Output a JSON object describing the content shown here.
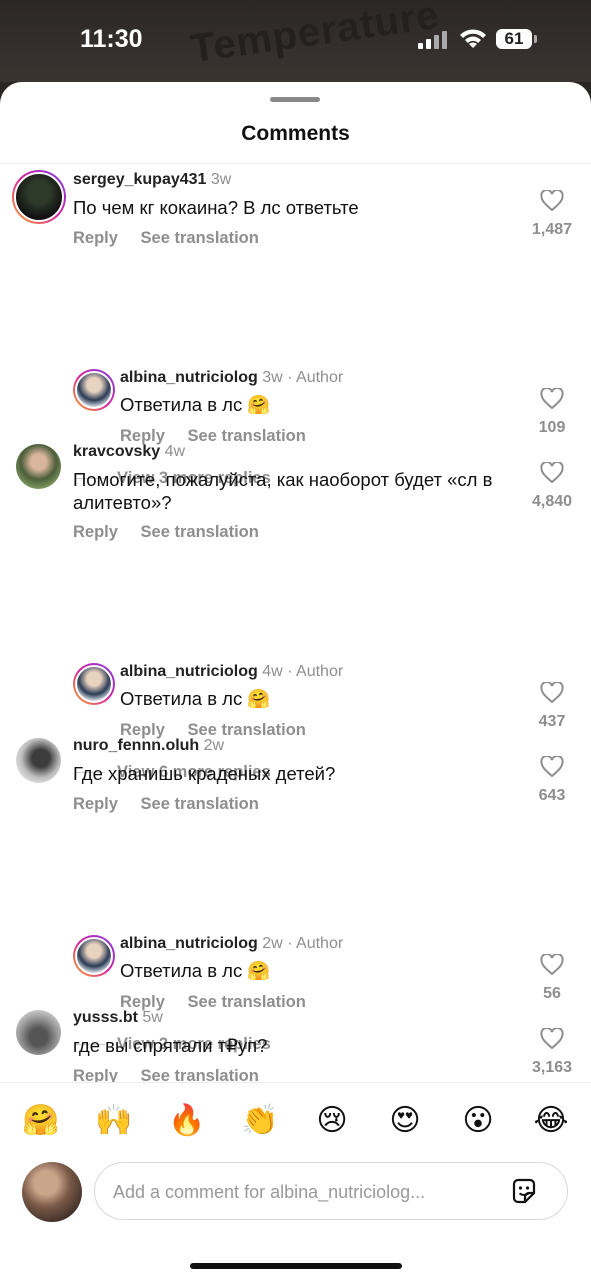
{
  "status_bar": {
    "time": "11:30",
    "battery": "61",
    "background_text": "Temperature",
    "icons": [
      "signal-icon",
      "wifi-icon",
      "battery-icon"
    ]
  },
  "sheet": {
    "title": "Comments"
  },
  "labels": {
    "reply": "Reply",
    "see_translation": "See translation"
  },
  "comments": [
    {
      "username": "sergey_kupay431",
      "time": "3w",
      "text": "По чем кг кокаина? В лс ответьте",
      "likes": "1,487",
      "reply": {
        "username": "albina_nutriciolog",
        "meta": "3w · Author",
        "text": "Ответила в лс",
        "emoji": "🤗",
        "likes": "109"
      },
      "view_more": "View 3 more replies"
    },
    {
      "username": "kravcovsky",
      "time": "4w",
      "text": "Помогите, пожалуйста, как наоборот будет «сл в алитевто»?",
      "likes": "4,840",
      "reply": {
        "username": "albina_nutriciolog",
        "meta": "4w · Author",
        "text": "Ответила в лс",
        "emoji": "🤗",
        "likes": "437"
      },
      "view_more": "View 6 more replies"
    },
    {
      "username": "nuro_fennn.oluh",
      "time": "2w",
      "text": "Где хранишь краденых детей?",
      "likes": "643",
      "reply": {
        "username": "albina_nutriciolog",
        "meta": "2w · Author",
        "text": "Ответила в лс",
        "emoji": "🤗",
        "likes": "56"
      },
      "view_more": "View 2 more replies"
    },
    {
      "username": "yusss.bt",
      "time": "5w",
      "text": "где вы спрятали т₽уп?",
      "likes": "3,163"
    }
  ],
  "emoji_bar": [
    "🤗",
    "🙌",
    "🔥",
    "👏",
    "😢",
    "😍",
    "😮",
    "😂"
  ],
  "composer": {
    "placeholder": "Add a comment for albina_nutriciolog..."
  },
  "colors": {
    "muted_text": "#8e8e8e",
    "text": "#111111",
    "sheet_bg": "#ffffff",
    "story_ring": "#d6249f"
  }
}
